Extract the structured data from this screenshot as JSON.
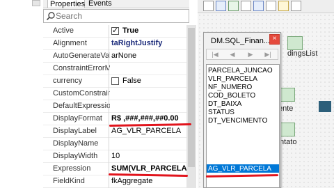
{
  "inspector": {
    "tabs": [
      "Properties",
      "Events"
    ],
    "search_placeholder": "Search",
    "properties": [
      {
        "name": "Active",
        "value": "True",
        "checkbox": true,
        "checked": true,
        "bold": true
      },
      {
        "name": "Alignment",
        "value": "taRightJustify",
        "bold": true
      },
      {
        "name": "AutoGenerateValue",
        "value": "arNone"
      },
      {
        "name": "ConstraintErrorMessage",
        "value": ""
      },
      {
        "name": "currency",
        "value": "False",
        "checkbox": true,
        "checked": false
      },
      {
        "name": "CustomConstraint",
        "value": ""
      },
      {
        "name": "DefaultExpression",
        "value": ""
      },
      {
        "name": "DisplayFormat",
        "value": "R$ ,###,###,##0.00",
        "bold": true
      },
      {
        "name": "DisplayLabel",
        "value": "AG_VLR_PARCELA"
      },
      {
        "name": "DisplayName",
        "value": ""
      },
      {
        "name": "DisplayWidth",
        "value": "10"
      },
      {
        "name": "Expression",
        "value": "SUM(VLR_PARCELA)",
        "bold": true
      },
      {
        "name": "FieldKind",
        "value": "fkAggregate"
      }
    ]
  },
  "designer": {
    "labels": [
      "dingsList",
      "ente",
      "ntato"
    ]
  },
  "fields_editor": {
    "title": "DM.SQL_Finan...",
    "close_glyph": "×",
    "nav_buttons": [
      "|◀",
      "◀",
      "▶",
      "▶|"
    ],
    "fields": [
      "PARCELA_JUNCAO",
      "VLR_PARCELA",
      "NF_NUMERO",
      "COD_BOLETO",
      "DT_BAIXA",
      "STATUS",
      "DT_VENCIMENTO"
    ],
    "aggregate_field": "AG_VLR_PARCELA"
  },
  "colors": {
    "annotation_red": "#e1141c",
    "selection_blue": "#0078d7",
    "close_red": "#e54a3d"
  }
}
